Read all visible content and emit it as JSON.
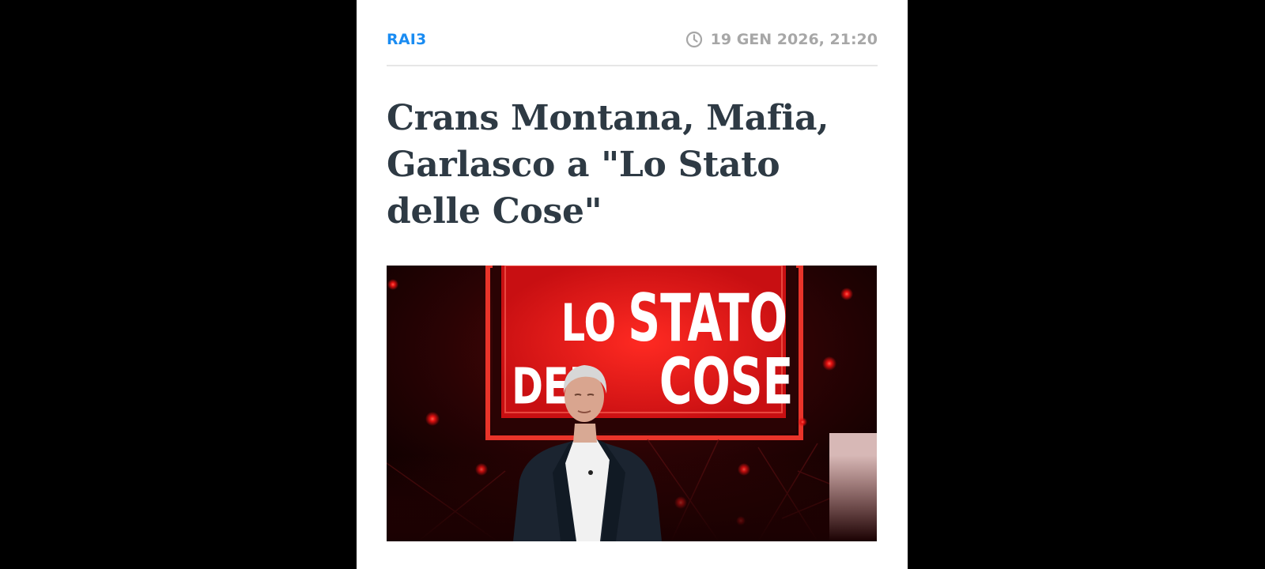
{
  "article": {
    "category": "RAI3",
    "timestamp": "19 GEN 2026, 21:20",
    "title": "Crans Montana, Mafia, Garlasco a \"Lo Stato delle Cose\"",
    "image": {
      "sign_line1_a": "LO",
      "sign_line1_b": "STATO",
      "sign_line2_a": "DEL",
      "sign_line2_b": "COSE"
    }
  },
  "icons": {
    "clock": "clock-icon"
  },
  "colors": {
    "accent": "#1a8cf2",
    "headline": "#2e3a44",
    "meta": "#a7a7a7",
    "sign_red": "#e31517"
  }
}
